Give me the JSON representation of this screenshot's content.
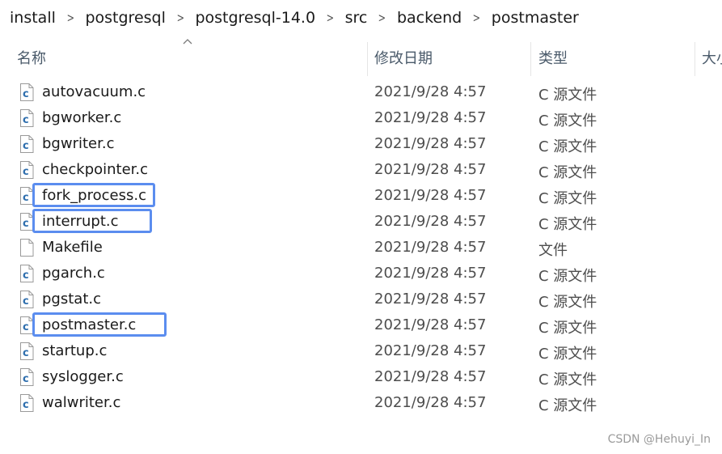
{
  "breadcrumb": [
    "install",
    "postgresql",
    "postgresql-14.0",
    "src",
    "backend",
    "postmaster"
  ],
  "columns": {
    "name": "名称",
    "date": "修改日期",
    "type": "类型",
    "size": "大小"
  },
  "files": [
    {
      "name": "autovacuum.c",
      "date": "2021/9/28 4:57",
      "type": "C 源文件",
      "icon": "c-source-file-icon",
      "highlighted": false
    },
    {
      "name": "bgworker.c",
      "date": "2021/9/28 4:57",
      "type": "C 源文件",
      "icon": "c-source-file-icon",
      "highlighted": false
    },
    {
      "name": "bgwriter.c",
      "date": "2021/9/28 4:57",
      "type": "C 源文件",
      "icon": "c-source-file-icon",
      "highlighted": false
    },
    {
      "name": "checkpointer.c",
      "date": "2021/9/28 4:57",
      "type": "C 源文件",
      "icon": "c-source-file-icon",
      "highlighted": false
    },
    {
      "name": "fork_process.c",
      "date": "2021/9/28 4:57",
      "type": "C 源文件",
      "icon": "c-source-file-icon",
      "highlighted": true
    },
    {
      "name": "interrupt.c",
      "date": "2021/9/28 4:57",
      "type": "C 源文件",
      "icon": "c-source-file-icon",
      "highlighted": true
    },
    {
      "name": "Makefile",
      "date": "2021/9/28 4:57",
      "type": "文件",
      "icon": "generic-file-icon",
      "highlighted": false
    },
    {
      "name": "pgarch.c",
      "date": "2021/9/28 4:57",
      "type": "C 源文件",
      "icon": "c-source-file-icon",
      "highlighted": false
    },
    {
      "name": "pgstat.c",
      "date": "2021/9/28 4:57",
      "type": "C 源文件",
      "icon": "c-source-file-icon",
      "highlighted": false
    },
    {
      "name": "postmaster.c",
      "date": "2021/9/28 4:57",
      "type": "C 源文件",
      "icon": "c-source-file-icon",
      "highlighted": true
    },
    {
      "name": "startup.c",
      "date": "2021/9/28 4:57",
      "type": "C 源文件",
      "icon": "c-source-file-icon",
      "highlighted": false
    },
    {
      "name": "syslogger.c",
      "date": "2021/9/28 4:57",
      "type": "C 源文件",
      "icon": "c-source-file-icon",
      "highlighted": false
    },
    {
      "name": "walwriter.c",
      "date": "2021/9/28 4:57",
      "type": "C 源文件",
      "icon": "c-source-file-icon",
      "highlighted": false
    }
  ],
  "colors": {
    "highlight_border": "#5b8def",
    "c_icon": "#2f6fae"
  },
  "watermark": "CSDN @Hehuyi_In"
}
